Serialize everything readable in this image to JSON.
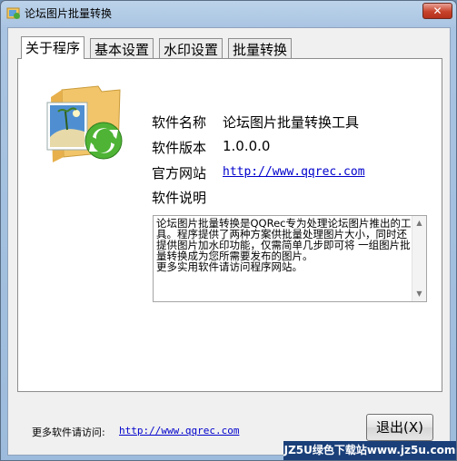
{
  "window": {
    "title": "论坛图片批量转换",
    "close_label": "✕"
  },
  "tabs": [
    {
      "label": "关于程序",
      "active": true
    },
    {
      "label": "基本设置",
      "active": false
    },
    {
      "label": "水印设置",
      "active": false
    },
    {
      "label": "批量转换",
      "active": false
    }
  ],
  "about": {
    "name_label": "软件名称",
    "name_value": "论坛图片批量转换工具",
    "version_label": "软件版本",
    "version_value": "1.0.0.0",
    "site_label": "官方网站",
    "site_value": "http://www.qqrec.com",
    "desc_label": "软件说明",
    "description": "论坛图片批量转换是QQRec专为处理论坛图片推出的工具。程序提供了两种方案供批量处理图片大小，同时还提供图片加水印功能，仅需简单几步即可将 一组图片批量转换成为您所需要发布的图片。\n更多实用软件请访问程序网站。"
  },
  "footer": {
    "more_label": "更多软件请访问:",
    "more_link": "http://www.qqrec.com",
    "exit_label": "退出(X)"
  },
  "watermark": "JZ5U绿色下载站www.jz5u.com",
  "icons": {
    "app": "picture-folder-icon",
    "about_graphic": "folder-sync-icon"
  }
}
